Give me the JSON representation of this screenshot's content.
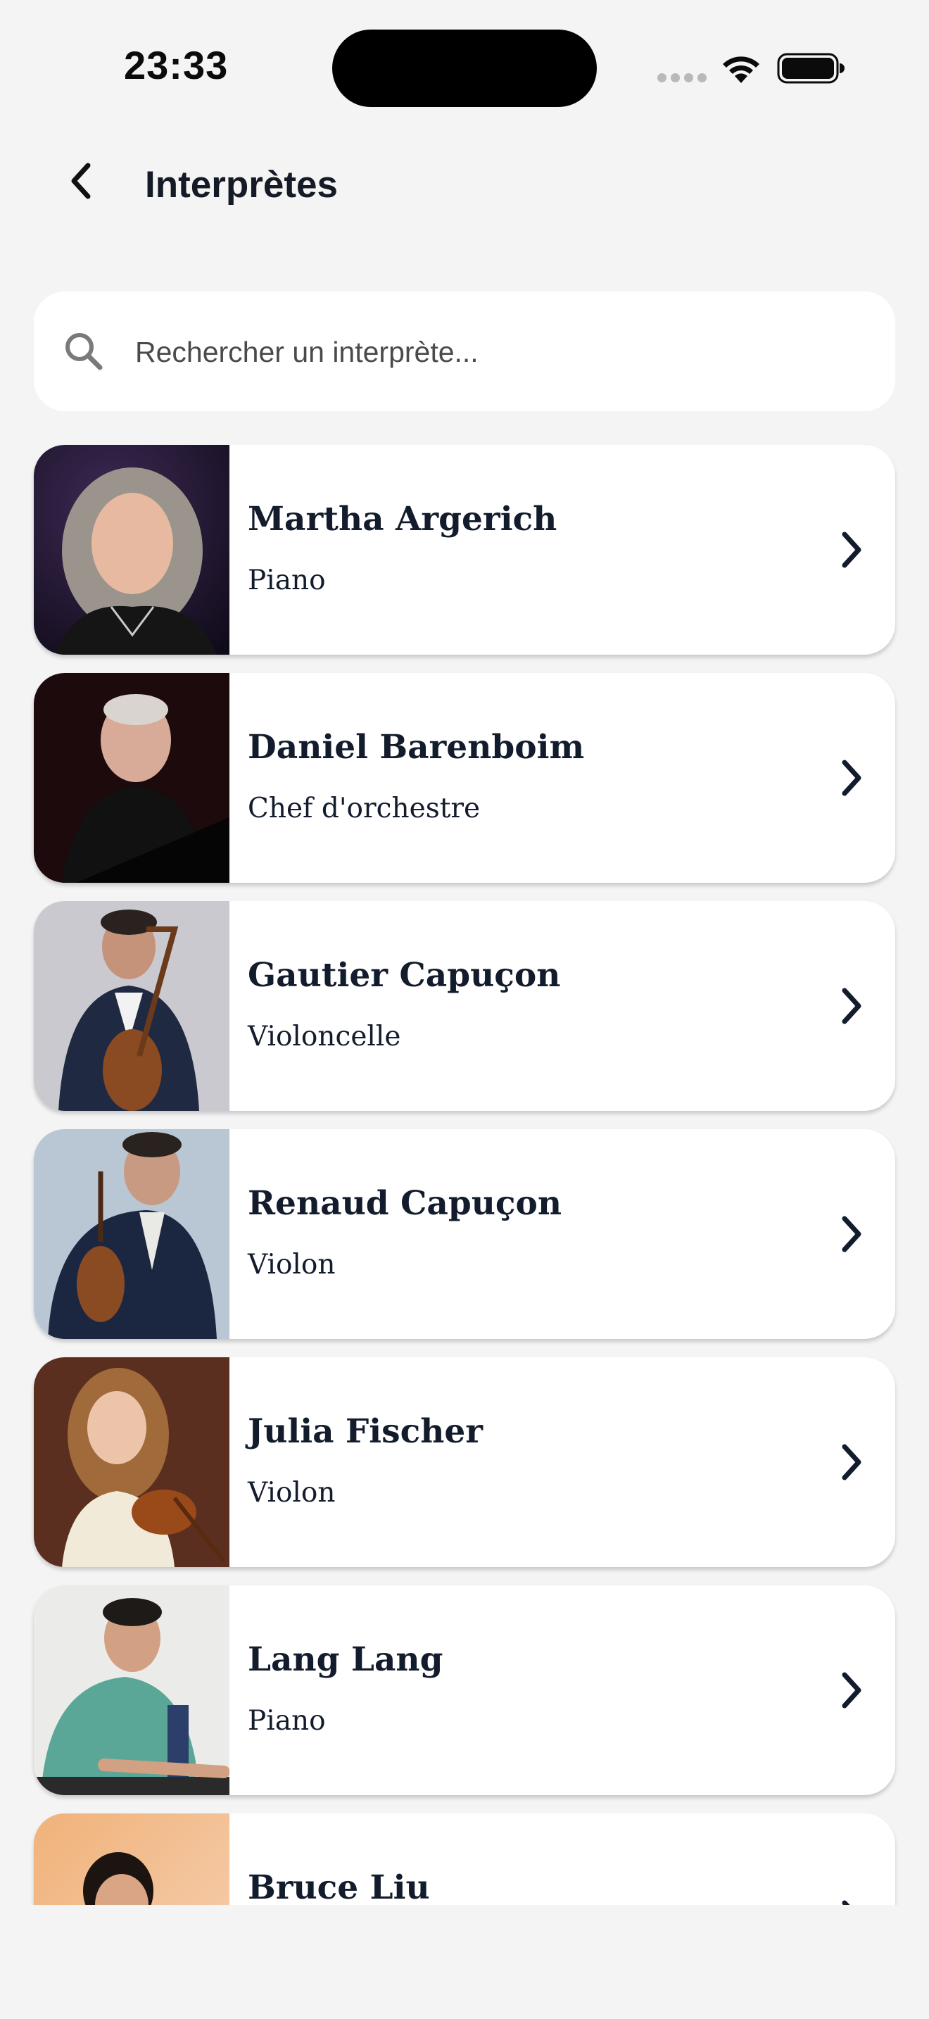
{
  "status_bar": {
    "time": "23:33"
  },
  "header": {
    "title": "Interprètes",
    "back_icon": "chevron-left-icon"
  },
  "search": {
    "placeholder": "Rechercher un interprète...",
    "value": "",
    "icon": "search-icon"
  },
  "artists": [
    {
      "name": "Martha Argerich",
      "role": "Piano"
    },
    {
      "name": "Daniel Barenboim",
      "role": "Chef d'orchestre"
    },
    {
      "name": "Gautier Capuçon",
      "role": "Violoncelle"
    },
    {
      "name": "Renaud Capuçon",
      "role": "Violon"
    },
    {
      "name": "Julia Fischer",
      "role": "Violon"
    },
    {
      "name": "Lang Lang",
      "role": "Piano"
    },
    {
      "name": "Bruce Liu",
      "role": ""
    }
  ],
  "colors": {
    "background": "#f4f4f4",
    "card": "#ffffff",
    "text_primary": "#131c2c"
  }
}
